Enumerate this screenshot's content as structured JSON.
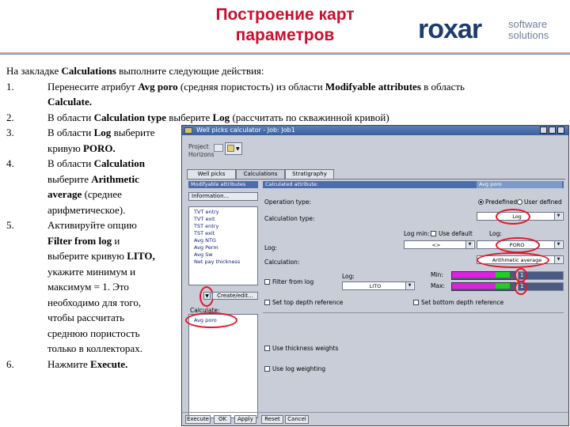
{
  "slide": {
    "title_line1": "Построение карт",
    "title_line2": "параметров",
    "logo": {
      "brand": "roxar",
      "tag1": "software",
      "tag2": "solutions",
      "brand_color": "#1d3c6e"
    },
    "accent_color": "#c8102e"
  },
  "instructions": {
    "intro_pre": "На закладке ",
    "intro_b": "Calculations",
    "intro_post": " выполните следующие действия:",
    "steps": [
      {
        "num": "1.",
        "lines": [
          {
            "parts": [
              {
                "t": "Перенесите атрибут "
              },
              {
                "t": "Avg poro",
                "b": true
              },
              {
                "t": " (средняя пористость) из области "
              },
              {
                "t": "Modifyable attributes",
                "b": true
              },
              {
                "t": " в область"
              }
            ]
          },
          {
            "parts": [
              {
                "t": "Calculate.",
                "b": true
              }
            ]
          }
        ]
      },
      {
        "num": "2.",
        "lines": [
          {
            "parts": [
              {
                "t": "В области "
              },
              {
                "t": "Calculation type",
                "b": true
              },
              {
                "t": " выберите "
              },
              {
                "t": "Log",
                "b": true
              },
              {
                "t": " (рассчитать по скважинной кривой)"
              }
            ]
          }
        ]
      },
      {
        "num": "3.",
        "lines": [
          {
            "parts": [
              {
                "t": "В области "
              },
              {
                "t": "Log",
                "b": true
              },
              {
                "t": " выберите"
              }
            ]
          },
          {
            "parts": [
              {
                "t": "кривую "
              },
              {
                "t": "PORO.",
                "b": true
              }
            ]
          }
        ]
      },
      {
        "num": "4.",
        "lines": [
          {
            "parts": [
              {
                "t": "В области "
              },
              {
                "t": "Calculation",
                "b": true
              }
            ]
          },
          {
            "parts": [
              {
                "t": "выберите "
              },
              {
                "t": "Arithmetic",
                "b": true
              }
            ]
          },
          {
            "parts": [
              {
                "t": "average",
                "b": true
              },
              {
                "t": " (среднее"
              }
            ]
          },
          {
            "parts": [
              {
                "t": "арифметическое)."
              }
            ]
          }
        ]
      },
      {
        "num": "5.",
        "lines": [
          {
            "parts": [
              {
                "t": "Активируйте опцию"
              }
            ]
          },
          {
            "parts": [
              {
                "t": "Filter from log",
                "b": true
              },
              {
                "t": " и"
              }
            ]
          },
          {
            "parts": [
              {
                "t": "выберите кривую "
              },
              {
                "t": "LITO,",
                "b": true
              }
            ]
          },
          {
            "parts": [
              {
                "t": "укажите минимум и"
              }
            ]
          },
          {
            "parts": [
              {
                "t": "максимум = 1. Это"
              }
            ]
          },
          {
            "parts": [
              {
                "t": "необходимо для того,"
              }
            ]
          },
          {
            "parts": [
              {
                "t": "чтобы рассчитать"
              }
            ]
          },
          {
            "parts": [
              {
                "t": "среднюю пористость"
              }
            ]
          },
          {
            "parts": [
              {
                "t": "только в коллекторах."
              }
            ]
          }
        ]
      },
      {
        "num": "6.",
        "lines": [
          {
            "parts": [
              {
                "t": "Нажмите "
              },
              {
                "t": "Execute.",
                "b": true
              }
            ]
          }
        ]
      }
    ]
  },
  "window": {
    "title": "Well picks calculator - Job: Job1",
    "project_label": "Project",
    "horizons_label": "Horizons",
    "tabs": [
      "Well picks",
      "Calculations",
      "Stratigraphy"
    ],
    "active_tab": 1,
    "modifiable_header": "Modifyable attributes",
    "information_btn": "Information...",
    "attributes": [
      "TVT entry",
      "TVT exit",
      "TST entry",
      "TST exit",
      "Avg NTG",
      "Avg Perm",
      "Avg Sw",
      "Net pay thickness"
    ],
    "create_edit_btn": "Create/edit...",
    "calculate_label": "Calculate:",
    "calculate_items": [
      "Avg poro"
    ],
    "calculated_attribute_label": "Calculated attribute:",
    "calculated_attribute_value": "Avg poro",
    "operation_type_label": "Operation type:",
    "predefined_label": "Predefined",
    "user_defined_label": "User defined",
    "calculation_type_label": "Calculation type:",
    "calculation_type_value": "Log",
    "log_min_label": "Log min:",
    "use_default_label": "Use default",
    "log_label_right": "Log:",
    "log_label": "Log:",
    "log_value": "PORO",
    "log_min_value": "<>",
    "calculation_label": "Calculation:",
    "calculation_value": "Arithmetic average",
    "filter_from_log_label": "Filter from log",
    "filter_log_label": "Log:",
    "filter_log_value": "LITO",
    "min_label": "Min:",
    "max_label": "Max:",
    "min_value": "1",
    "max_value": "1",
    "set_top_depth_label": "Set top depth reference",
    "set_bottom_depth_label": "Set bottom depth reference",
    "use_thickness_label": "Use thickness weights",
    "use_log_weighting_label": "Use log weighting",
    "buttons": [
      "Execute",
      "OK",
      "Apply",
      "Reset",
      "Cancel"
    ],
    "title_bar_color": "#3b5f9b",
    "highlight_color": "#e3172b",
    "slider_color": "#e020e0"
  }
}
